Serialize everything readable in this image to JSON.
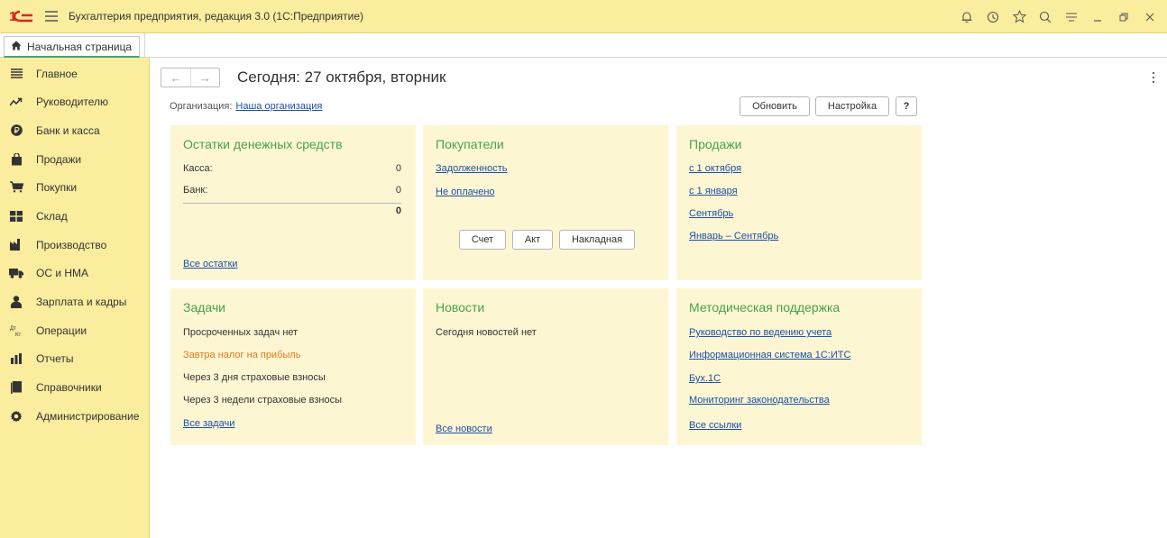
{
  "app": {
    "title": "Бухгалтерия предприятия, редакция 3.0  (1С:Предприятие)",
    "accent_color": "#fbed9e",
    "title_icons": [
      "bell-icon",
      "history-icon",
      "star-icon",
      "search-icon",
      "menu-icon",
      "minimize-icon",
      "restore-icon",
      "close-icon"
    ]
  },
  "tabs": [
    {
      "label": "Начальная страница",
      "icon": "home-icon"
    }
  ],
  "sidebar": {
    "items": [
      {
        "label": "Главное",
        "icon": "list-icon"
      },
      {
        "label": "Руководителю",
        "icon": "trend-icon"
      },
      {
        "label": "Банк и касса",
        "icon": "ruble-icon"
      },
      {
        "label": "Продажи",
        "icon": "bag-icon"
      },
      {
        "label": "Покупки",
        "icon": "cart-icon"
      },
      {
        "label": "Склад",
        "icon": "warehouse-icon"
      },
      {
        "label": "Производство",
        "icon": "factory-icon"
      },
      {
        "label": "ОС и НМА",
        "icon": "truck-icon"
      },
      {
        "label": "Зарплата и кадры",
        "icon": "person-icon"
      },
      {
        "label": "Операции",
        "icon": "dt-kt-icon"
      },
      {
        "label": "Отчеты",
        "icon": "bar-chart-icon"
      },
      {
        "label": "Справочники",
        "icon": "book-icon"
      },
      {
        "label": "Администрирование",
        "icon": "gear-icon"
      }
    ]
  },
  "main": {
    "title": "Сегодня: 27 октября, вторник",
    "org_label": "Организация:",
    "org_value": "Наша организация",
    "buttons": {
      "refresh": "Обновить",
      "settings": "Настройка",
      "help": "?"
    }
  },
  "panels": {
    "cash": {
      "title": "Остатки денежных средств",
      "rows": [
        {
          "label": "Касса:",
          "value": "0"
        },
        {
          "label": "Банк:",
          "value": "0"
        }
      ],
      "total": "0",
      "link": "Все остатки"
    },
    "customers": {
      "title": "Покупатели",
      "links": [
        "Задолженность",
        "Не оплачено"
      ],
      "buttons": [
        "Счет",
        "Акт",
        "Накладная"
      ]
    },
    "sales": {
      "title": "Продажи",
      "links": [
        "с 1 октября",
        "с 1 января",
        "Сентябрь",
        "Январь – Сентябрь"
      ]
    },
    "tasks": {
      "title": "Задачи",
      "items": [
        "Просроченных задач нет",
        "Завтра налог на прибыль",
        "Через 3 дня страховые взносы",
        "Через 3 недели страховые взносы"
      ],
      "link": "Все задачи"
    },
    "news": {
      "title": "Новости",
      "text": "Сегодня новостей нет",
      "link": "Все новости"
    },
    "support": {
      "title": "Методическая поддержка",
      "links": [
        "Руководство по ведению учета",
        "Информационная система 1С:ИТС",
        "Бух.1С",
        "Мониторинг законодательства"
      ],
      "link": "Все ссылки"
    }
  }
}
